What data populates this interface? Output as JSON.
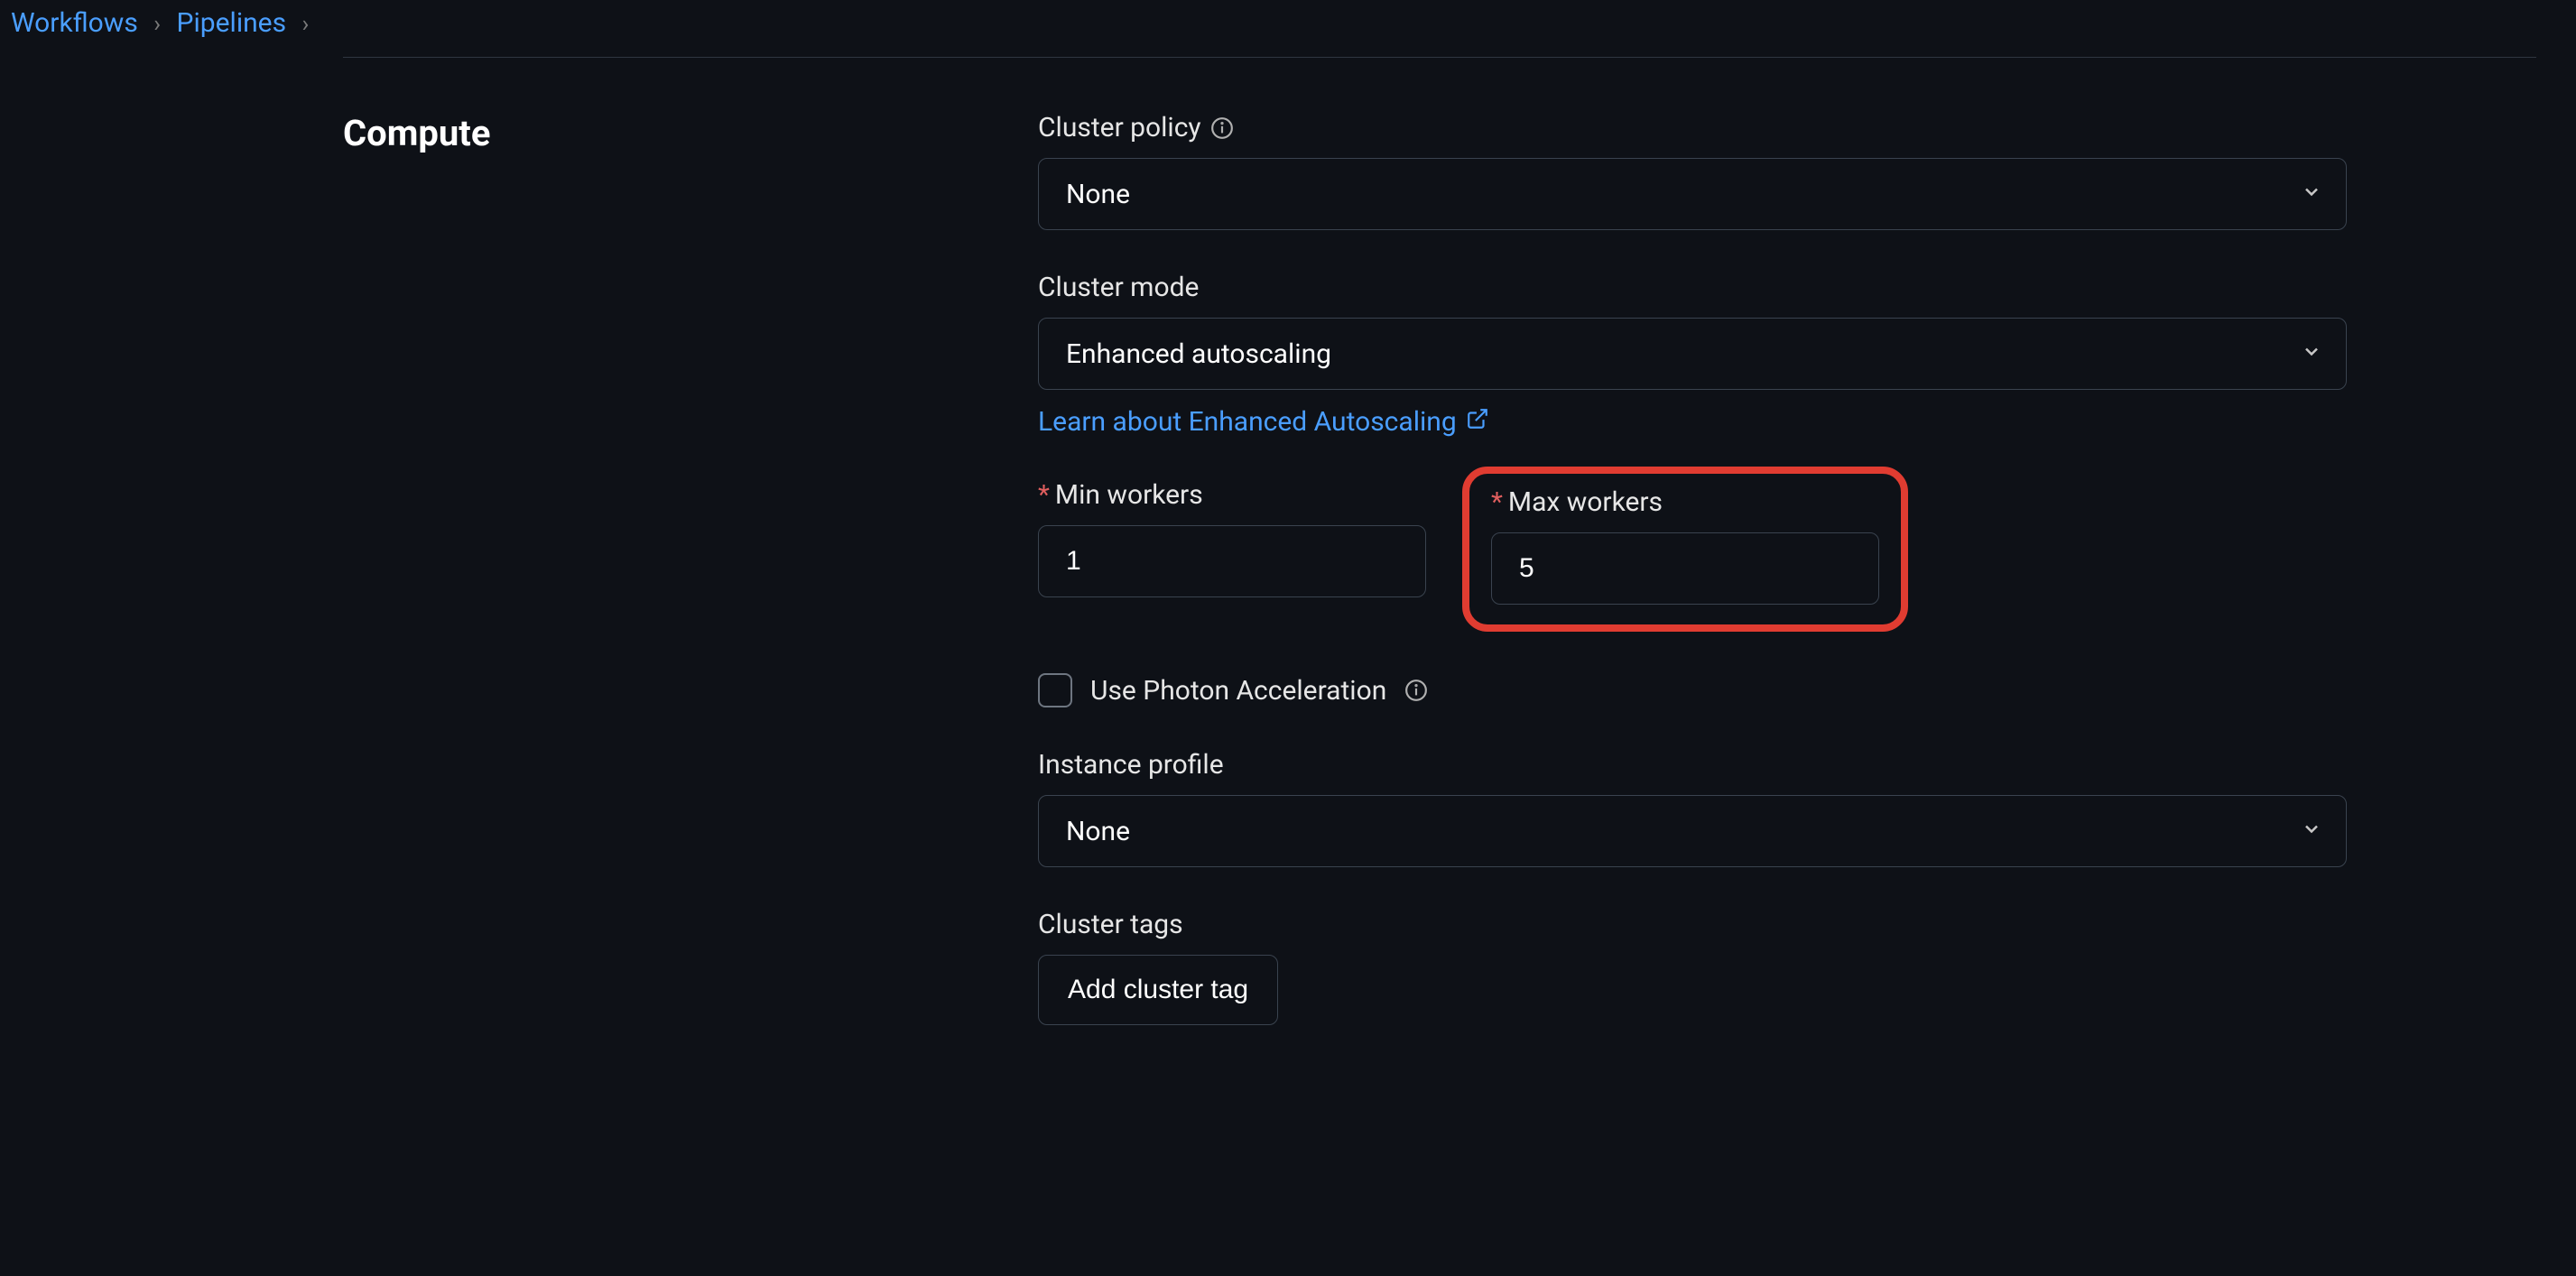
{
  "breadcrumb": {
    "items": [
      "Workflows",
      "Pipelines"
    ]
  },
  "section": {
    "title": "Compute"
  },
  "cluster_policy": {
    "label": "Cluster policy",
    "value": "None"
  },
  "cluster_mode": {
    "label": "Cluster mode",
    "value": "Enhanced autoscaling",
    "link_text": "Learn about Enhanced Autoscaling"
  },
  "min_workers": {
    "label": "Min workers",
    "value": "1"
  },
  "max_workers": {
    "label": "Max workers",
    "value": "5"
  },
  "photon": {
    "label": "Use Photon Acceleration"
  },
  "instance_profile": {
    "label": "Instance profile",
    "value": "None"
  },
  "cluster_tags": {
    "label": "Cluster tags",
    "button": "Add cluster tag"
  }
}
